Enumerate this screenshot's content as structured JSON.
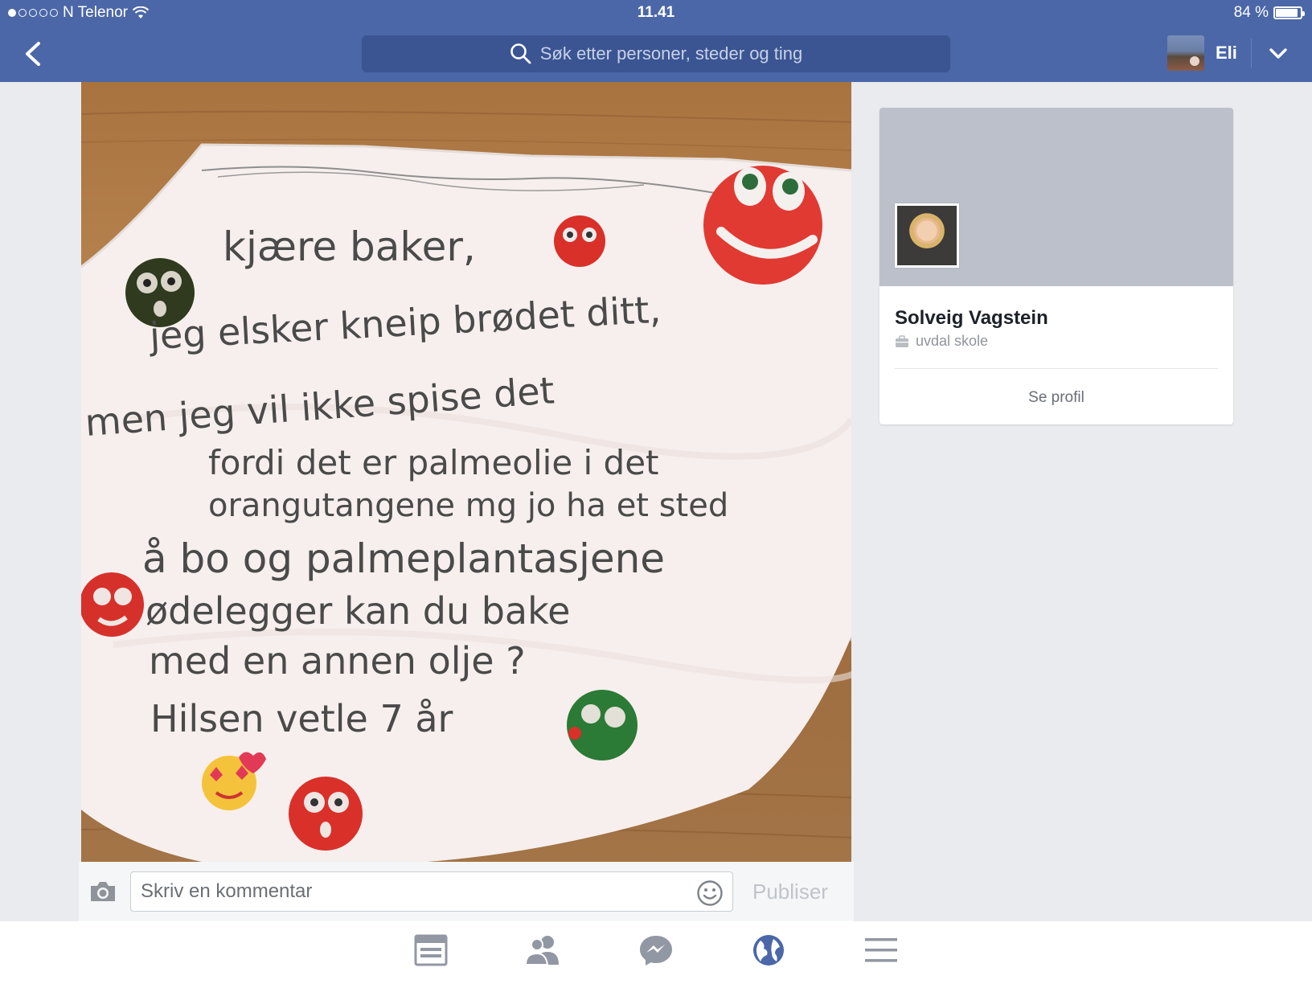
{
  "status_bar": {
    "carrier": "N Telenor",
    "time": "11.41",
    "battery": "84 %",
    "battery_level": 0.84
  },
  "nav": {
    "search_placeholder": "Søk etter personer, steder og ting",
    "user_name": "Eli"
  },
  "photo": {
    "letter_lines": [
      "kjære baker,",
      "jeg elsker kneip brødet ditt,",
      "men jeg vil ikke spise det",
      "fordi det er palmeolie i det",
      "orangutangene mg jo ha et sted",
      "å bo og palmeplantasjene",
      "ødelegger kan du bake",
      "med en annen olje ?",
      "Hilsen vetle 7 år"
    ]
  },
  "comment": {
    "placeholder": "Skriv en kommentar",
    "publish_label": "Publiser"
  },
  "profile": {
    "name": "Solveig Vagstein",
    "workplace": "uvdal skole",
    "see_profile": "Se profil"
  },
  "colors": {
    "brand": "#4b67a8",
    "active_tab": "#4b67a8",
    "inactive_tab": "#9197a3"
  },
  "tabs": [
    {
      "icon": "news-feed-icon",
      "active": false
    },
    {
      "icon": "friends-icon",
      "active": false
    },
    {
      "icon": "messenger-icon",
      "active": false
    },
    {
      "icon": "globe-notifications-icon",
      "active": true
    },
    {
      "icon": "menu-icon",
      "active": false
    }
  ]
}
